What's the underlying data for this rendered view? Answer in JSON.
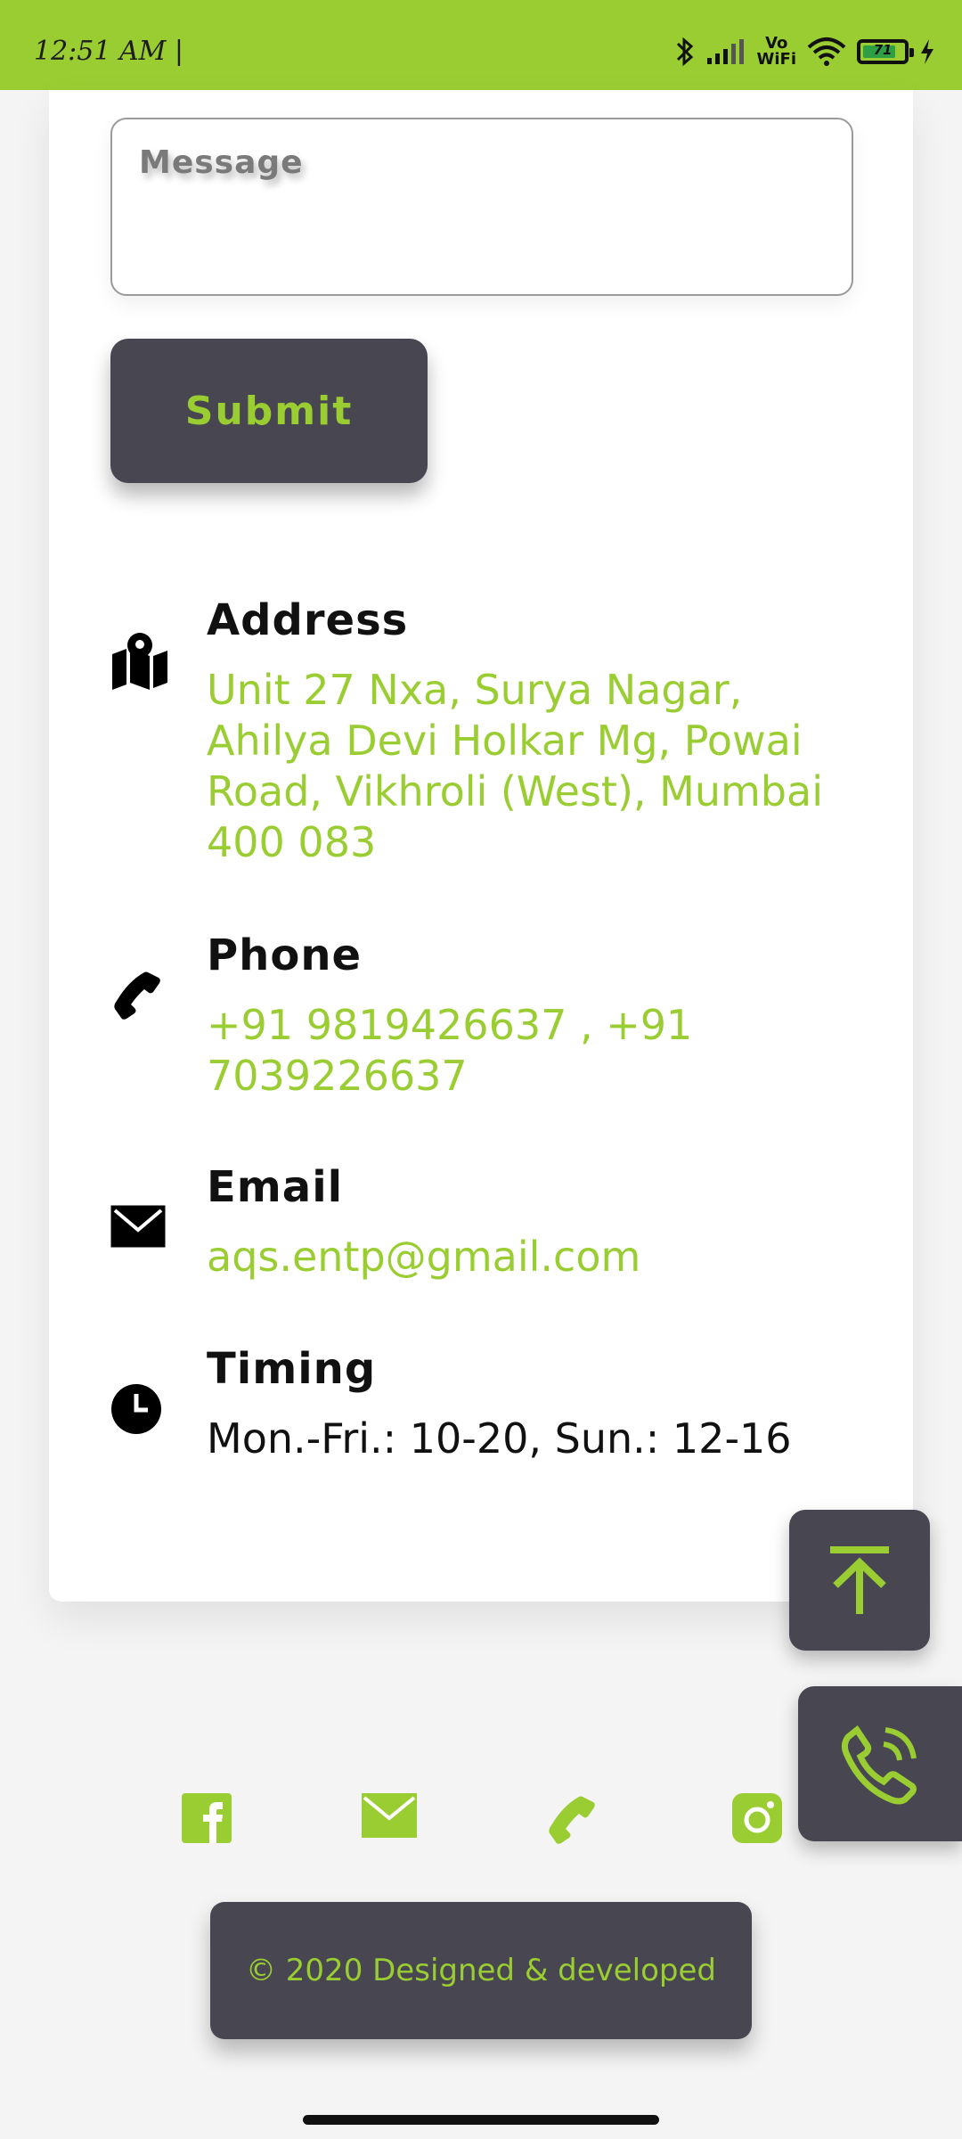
{
  "status_bar": {
    "time": "12:51 AM |",
    "network_label_top": "Vo",
    "network_label_bottom": "WiFi",
    "battery": "71"
  },
  "form": {
    "message_placeholder": "Message",
    "submit_label": "Submit"
  },
  "contact": {
    "address": {
      "title": "Address",
      "text": "Unit 27 Nxa, Surya Nagar, Ahilya Devi Holkar Mg, Powai Road, Vikhroli (West), Mumbai 400 083",
      "icon": "map-pin-icon"
    },
    "phone": {
      "title": "Phone",
      "text": "+91 9819426637 , +91 7039226637",
      "icon": "phone-icon"
    },
    "email": {
      "title": "Email",
      "text": "aqs.entp@gmail.com",
      "icon": "envelope-icon"
    },
    "timing": {
      "title": "Timing",
      "text": "Mon.-Fri.: 10-20, Sun.: 12-16",
      "icon": "clock-icon"
    }
  },
  "social": [
    "facebook-icon",
    "mail-icon",
    "phone-icon",
    "instagram-icon"
  ],
  "footer": {
    "text": "© 2020 Designed & developed"
  },
  "colors": {
    "accent": "#9acd32",
    "dark": "#484650",
    "background": "#f4f4f4"
  }
}
